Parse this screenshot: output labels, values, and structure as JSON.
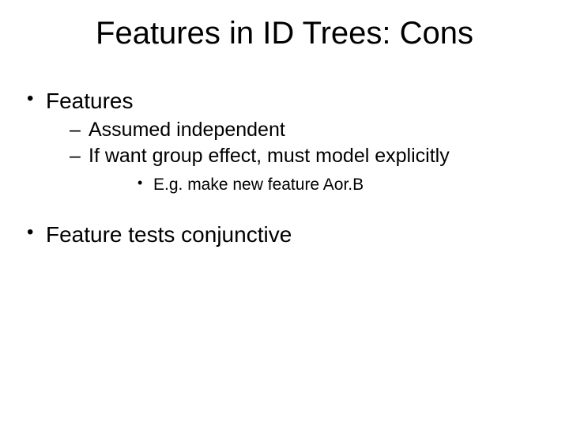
{
  "title": "Features in ID Trees: Cons",
  "bullets": {
    "b1": "Features",
    "b1_1": "Assumed independent",
    "b1_2": "If want group effect, must model explicitly",
    "b1_2_1": "E.g. make new feature Aor.B",
    "b2": "Feature tests conjunctive"
  }
}
